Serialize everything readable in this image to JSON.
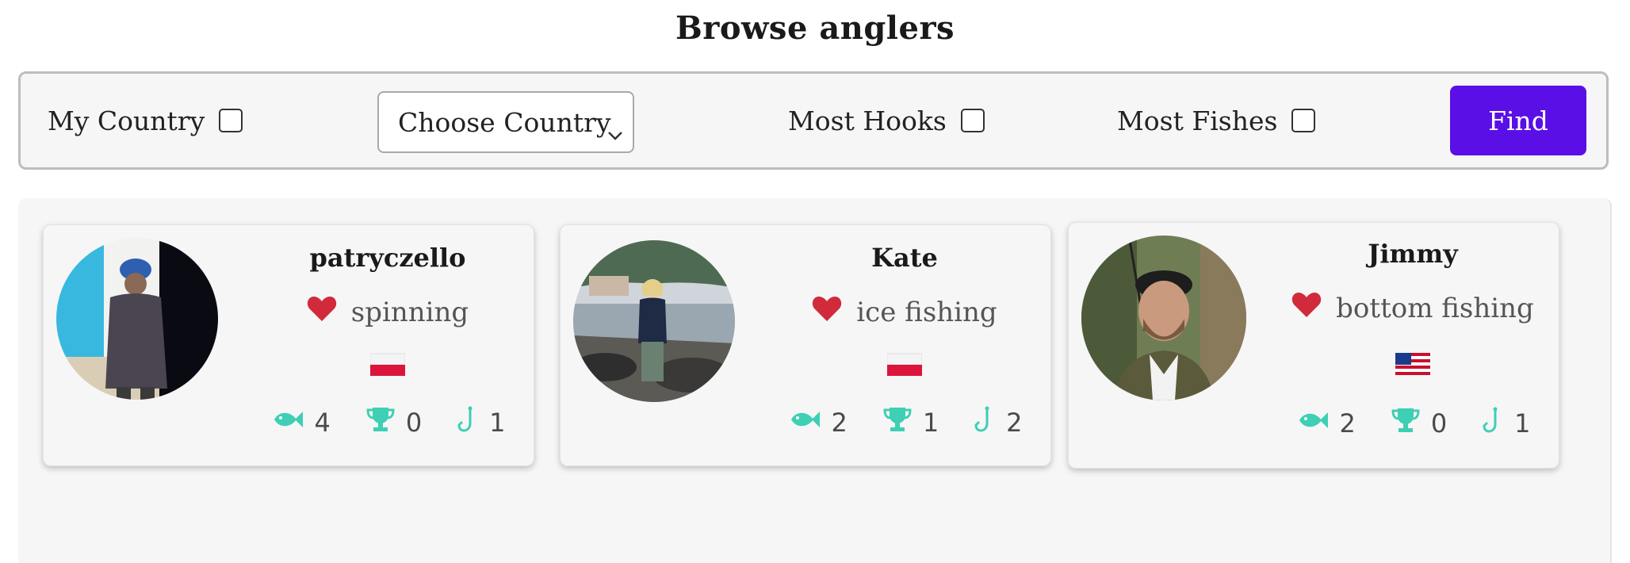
{
  "page": {
    "title": "Browse anglers"
  },
  "filters": {
    "my_country_label": "My Country",
    "country_select_value": "Choose Country",
    "most_hooks_label": "Most Hooks",
    "most_fishes_label": "Most Fishes",
    "find_label": "Find"
  },
  "colors": {
    "accent": "#5a0fe6",
    "heart": "#d12b3b",
    "stat_icon": "#3ecfb4"
  },
  "anglers": [
    {
      "name": "patryczello",
      "style": "spinning",
      "flag": "poland-flag",
      "fishes": "4",
      "trophies": "0",
      "hooks": "1"
    },
    {
      "name": "Kate",
      "style": "ice fishing",
      "flag": "poland-flag",
      "fishes": "2",
      "trophies": "1",
      "hooks": "2"
    },
    {
      "name": "Jimmy",
      "style": "bottom fishing",
      "flag": "usa-flag",
      "fishes": "2",
      "trophies": "0",
      "hooks": "1"
    }
  ]
}
